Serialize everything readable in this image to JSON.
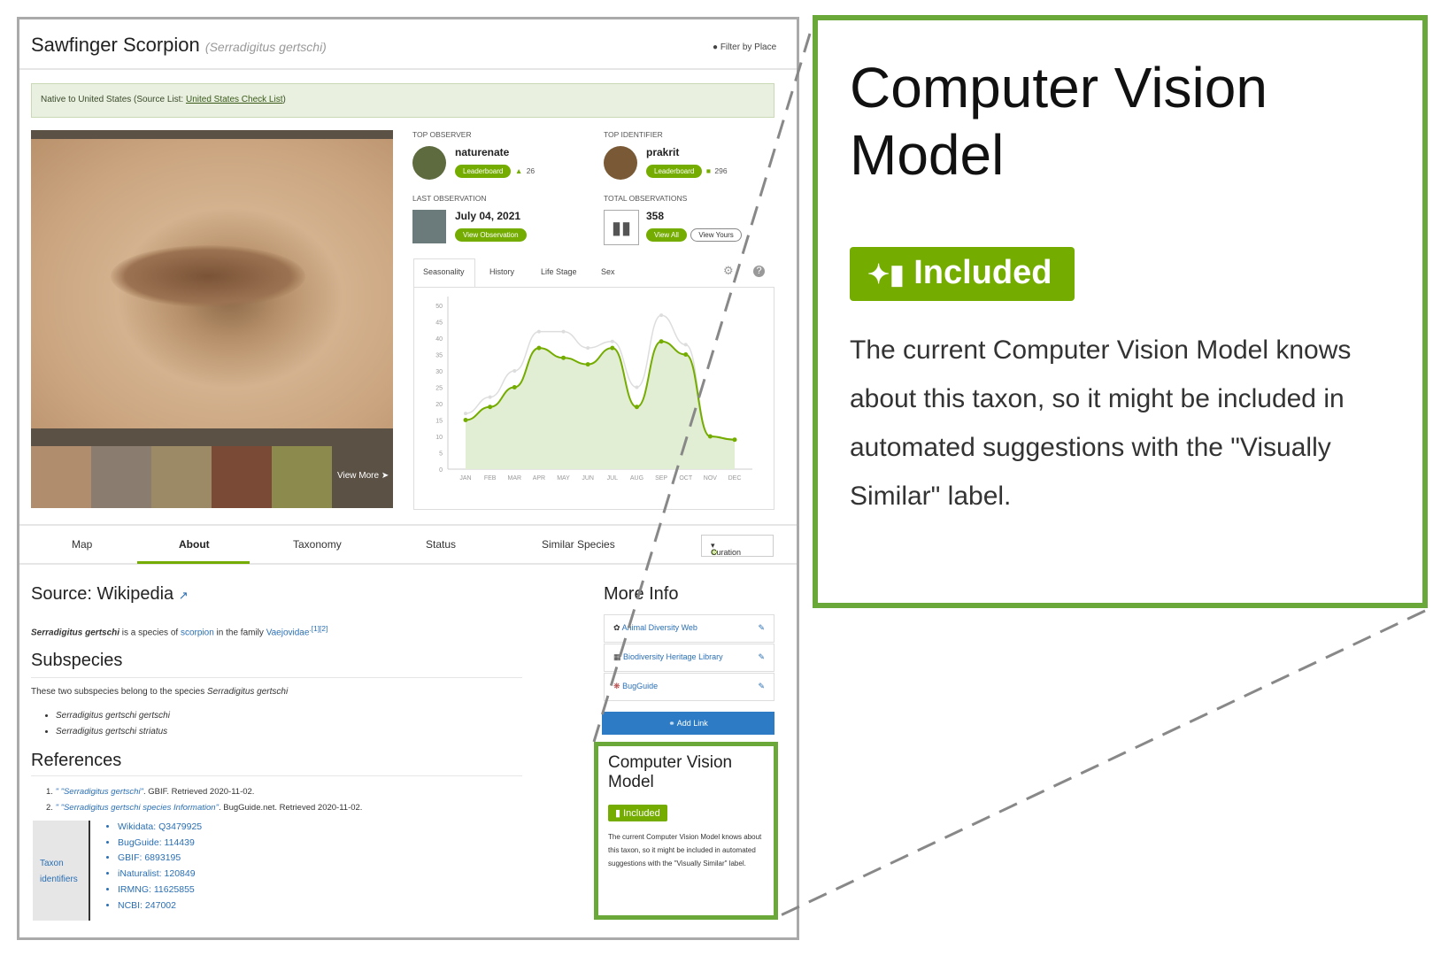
{
  "header": {
    "common_name": "Sawfinger Scorpion",
    "scientific_name": "(Serradigitus gertschi)",
    "filter_label": "Filter by Place"
  },
  "banner": {
    "text": "Native to United States (Source List: ",
    "link": "United States Check List",
    "close": ")"
  },
  "photos": {
    "view_more": "View More"
  },
  "stats": {
    "top_observer": {
      "label": "TOP OBSERVER",
      "name": "naturenate",
      "button": "Leaderboard",
      "count": "26"
    },
    "top_identifier": {
      "label": "TOP IDENTIFIER",
      "name": "prakrit",
      "button": "Leaderboard",
      "count": "296"
    },
    "last_observation": {
      "label": "LAST OBSERVATION",
      "date": "July 04, 2021",
      "button": "View Observation"
    },
    "total_observations": {
      "label": "TOTAL OBSERVATIONS",
      "count": "358",
      "view_all": "View All",
      "view_yours": "View Yours"
    }
  },
  "chart_tabs": [
    "Seasonality",
    "History",
    "Life Stage",
    "Sex"
  ],
  "chart_data": {
    "type": "area",
    "categories": [
      "JAN",
      "FEB",
      "MAR",
      "APR",
      "MAY",
      "JUN",
      "JUL",
      "AUG",
      "SEP",
      "OCT",
      "NOV",
      "DEC"
    ],
    "series": [
      {
        "values": [
          17,
          22,
          30,
          42,
          42,
          37,
          39,
          25,
          47,
          38,
          10,
          9
        ],
        "color": "#dddddd"
      },
      {
        "values": [
          15,
          19,
          25,
          37,
          34,
          32,
          37,
          19,
          39,
          35,
          10,
          9
        ],
        "color": "#74ac00"
      }
    ],
    "yticks": [
      0,
      5,
      10,
      15,
      20,
      25,
      30,
      35,
      40,
      45,
      50
    ],
    "ylim": [
      0,
      50
    ],
    "grid": false
  },
  "tabs": {
    "items": [
      "Map",
      "About",
      "Taxonomy",
      "Status",
      "Similar Species"
    ],
    "active": "About",
    "curation": "Curation"
  },
  "about": {
    "source_heading": "Source: Wikipedia",
    "intro_species": "Serradigitus gertschi",
    "intro_1": " is a species of ",
    "intro_link1": "scorpion",
    "intro_2": " in the family ",
    "intro_link2": "Vaejovidae",
    "intro_refs": ".[1][2]",
    "subspecies_heading": "Subspecies",
    "subspecies_intro": "These two subspecies belong to the species ",
    "subspecies_intro_species": "Serradigitus gertschi",
    "subspecies": [
      "Serradigitus gertschi gertschi",
      "Serradigitus gertschi striatus"
    ],
    "references_heading": "References",
    "references": [
      {
        "num": "1.",
        "link": "\" \"Serradigitus gertschi\"",
        "source": ". GBIF. Retrieved 2020-11-02."
      },
      {
        "num": "2.",
        "link": "\" \"Serradigitus gertschi species Information\"",
        "source": ". BugGuide.net. Retrieved 2020-11-02."
      }
    ],
    "taxon_identifiers_label": "Taxon identifiers",
    "identifiers": [
      "Wikidata: Q3479925",
      "BugGuide: 114439",
      "GBIF: 6893195",
      "iNaturalist: 120849",
      "IRMNG: 11625855",
      "NCBI: 247002"
    ]
  },
  "more_info": {
    "heading": "More Info",
    "links": [
      "Animal Diversity Web",
      "Biodiversity Heritage Library",
      "BugGuide"
    ],
    "add_link": "Add Link"
  },
  "cv": {
    "title": "Computer Vision Model",
    "badge": "Included",
    "text": "The current Computer Vision Model knows about this taxon, so it might be included in automated suggestions with the \"Visually Similar\" label."
  }
}
